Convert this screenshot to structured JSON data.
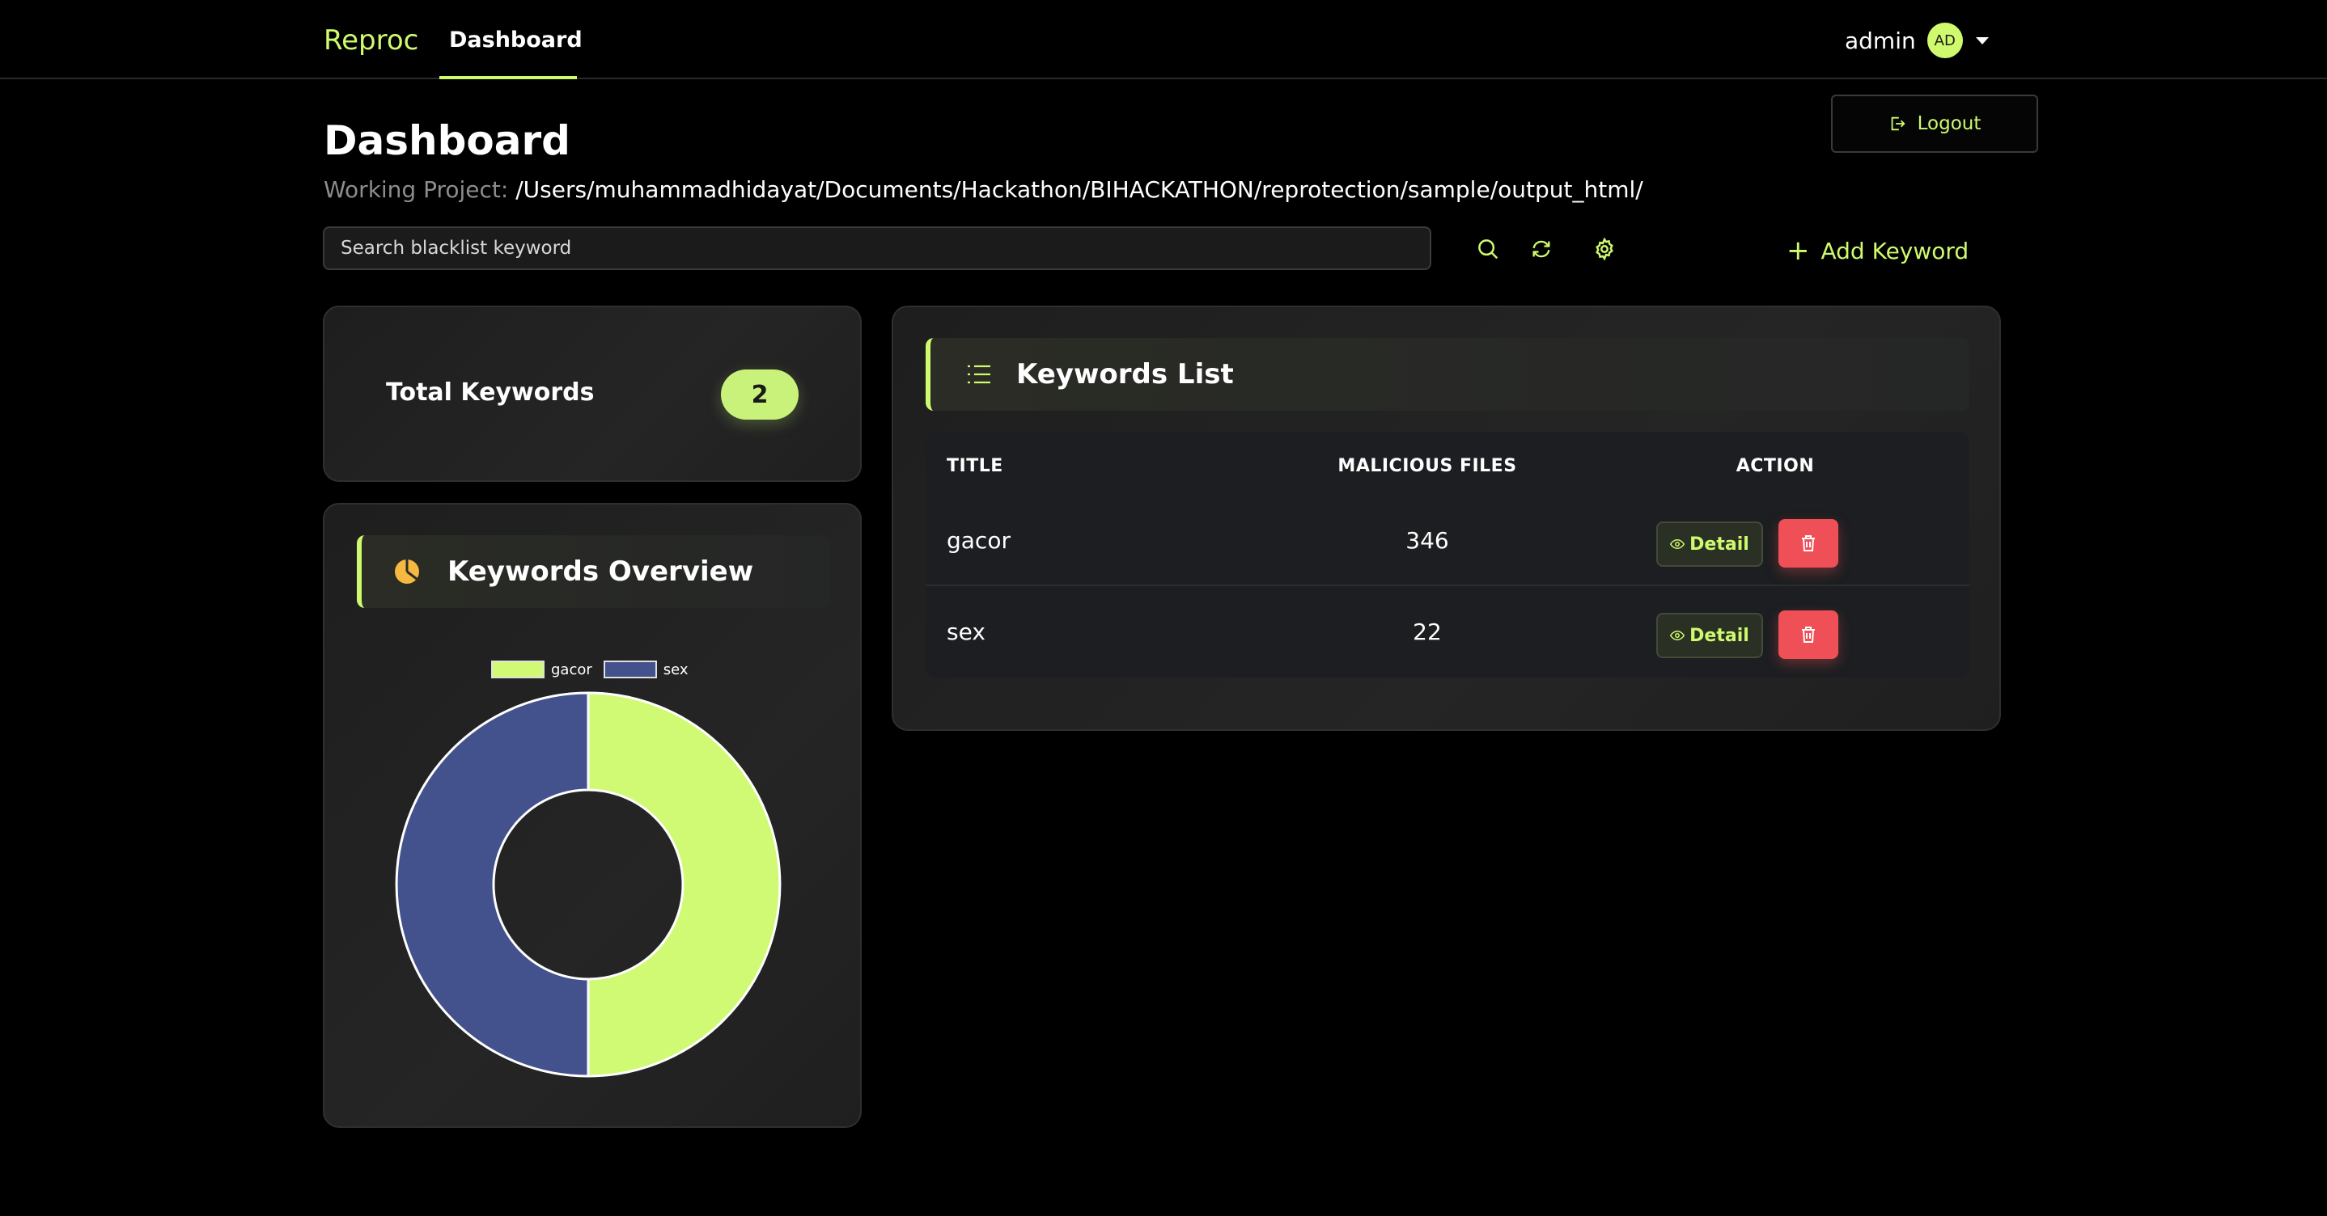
{
  "nav": {
    "brand": "Reproc",
    "tab_dashboard": "Dashboard",
    "user_name": "admin",
    "avatar_initials": "AD"
  },
  "header": {
    "logout_label": "Logout",
    "page_title": "Dashboard",
    "project_label": "Working Project:",
    "project_path": "/Users/muhammadhidayat/Documents/Hackathon/BIHACKATHON/reprotection/sample/output_html/"
  },
  "search": {
    "placeholder": "Search blacklist keyword"
  },
  "toolbar": {
    "icons": [
      "search-icon",
      "refresh-icon",
      "gear-icon"
    ],
    "add_keyword_label": "Add Keyword"
  },
  "total": {
    "label": "Total Keywords",
    "count": "2"
  },
  "overview": {
    "title": "Keywords Overview"
  },
  "keywords_list": {
    "title": "Keywords List",
    "columns": [
      "TITLE",
      "MALICIOUS FILES",
      "ACTION"
    ],
    "rows": [
      {
        "title": "gacor",
        "malicious_files": "346",
        "detail_label": "Detail"
      },
      {
        "title": "sex",
        "malicious_files": "22",
        "detail_label": "Detail"
      }
    ]
  },
  "colors": {
    "accent": "#cffa6e",
    "danger": "#ef4f56",
    "series_gacor": "#d0fa74",
    "series_sex": "#43528c"
  },
  "chart_data": {
    "type": "pie",
    "donut": true,
    "categories": [
      "gacor",
      "sex"
    ],
    "values": [
      50,
      50
    ],
    "legend_position": "top",
    "title": ""
  }
}
